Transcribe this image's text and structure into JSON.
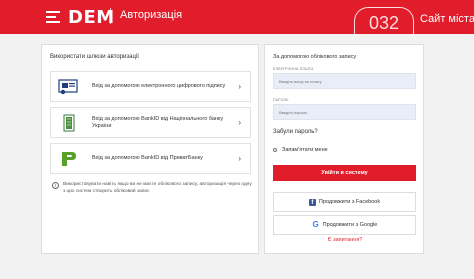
{
  "header": {
    "logo_text": "DEM",
    "page_label": "Авторизація",
    "hotline_number": "032",
    "site_name": "Сайт міста",
    "brand_color": "#e11d2b"
  },
  "gateways": {
    "title": "Використати шлюзи авторизації",
    "methods": [
      {
        "label": "Вхід за допомогою електронного цифрового підпису",
        "icon": "digital-signature-icon"
      },
      {
        "label": "Вхід за допомогою BankID від Національного банку України",
        "icon": "nbu-bankid-icon"
      },
      {
        "label": "Вхід за допомогою BankID від ПриватБанку",
        "icon": "privatbank-icon"
      }
    ],
    "note": "Використовувати навіть якщо ви не маєте облікового запису, авторизація через одну з цих систем створить обліковий запис"
  },
  "account_form": {
    "title": "За допомогою облікового запису",
    "email_label": "ЕЛЕКТРОННА ПОШТА",
    "email_placeholder": "Введіть вашу ел.пошту",
    "password_label": "ПАРОЛЬ",
    "password_placeholder": "Введіть пароль",
    "forgot_label": "Забули пароль?",
    "remember_label": "Запам'ятати мене",
    "login_label": "Увійти в систему",
    "facebook_label": "Продовжити з Facebook",
    "google_label": "Продовжити з Google",
    "help_label": "Є запитання?"
  }
}
